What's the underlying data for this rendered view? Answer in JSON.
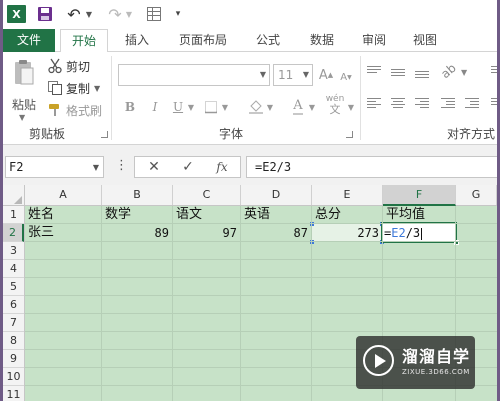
{
  "app": {
    "logo_letter": "X"
  },
  "tabs": {
    "file": "文件",
    "home": "开始",
    "insert": "插入",
    "layout": "页面布局",
    "formula": "公式",
    "data": "数据",
    "review": "审阅",
    "view": "视图"
  },
  "clipboard": {
    "paste": "粘贴",
    "cut": "剪切",
    "copy": "复制",
    "format_painter": "格式刷",
    "group_label": "剪贴板"
  },
  "font": {
    "name": "",
    "size": "11",
    "grow_label": "A",
    "shrink_label": "A",
    "bold": "B",
    "italic": "I",
    "underline": "U",
    "font_color_label": "A",
    "phonetic_top": "wén",
    "phonetic_bottom": "文",
    "group_label": "字体"
  },
  "alignment": {
    "group_label": "对齐方式"
  },
  "formula_bar": {
    "name_box": "F2",
    "fx": "fx",
    "formula": "=E2/3"
  },
  "sheet": {
    "columns": [
      "A",
      "B",
      "C",
      "D",
      "E",
      "F",
      "G"
    ],
    "active_column": "F",
    "rows": [
      "1",
      "2",
      "3",
      "4",
      "5",
      "6",
      "7",
      "8",
      "9",
      "10",
      "11"
    ],
    "active_row": "2",
    "cells": {
      "A1": "姓名",
      "B1": "数学",
      "C1": "语文",
      "D1": "英语",
      "E1": "总分",
      "F1": "平均值",
      "A2": "张三",
      "B2": "89",
      "C2": "97",
      "D2": "87",
      "E2": "273"
    },
    "editing": {
      "prefix": "=",
      "ref": "E2",
      "suffix": "/3"
    }
  },
  "watermark": {
    "title": "溜溜自学",
    "url": "ZIXUE.3D66.COM"
  },
  "colors": {
    "accent": "#217346",
    "reference_blue": "#3c78d8",
    "sheet_tint": "#c7e2c8",
    "frame": "#6f5b86"
  }
}
